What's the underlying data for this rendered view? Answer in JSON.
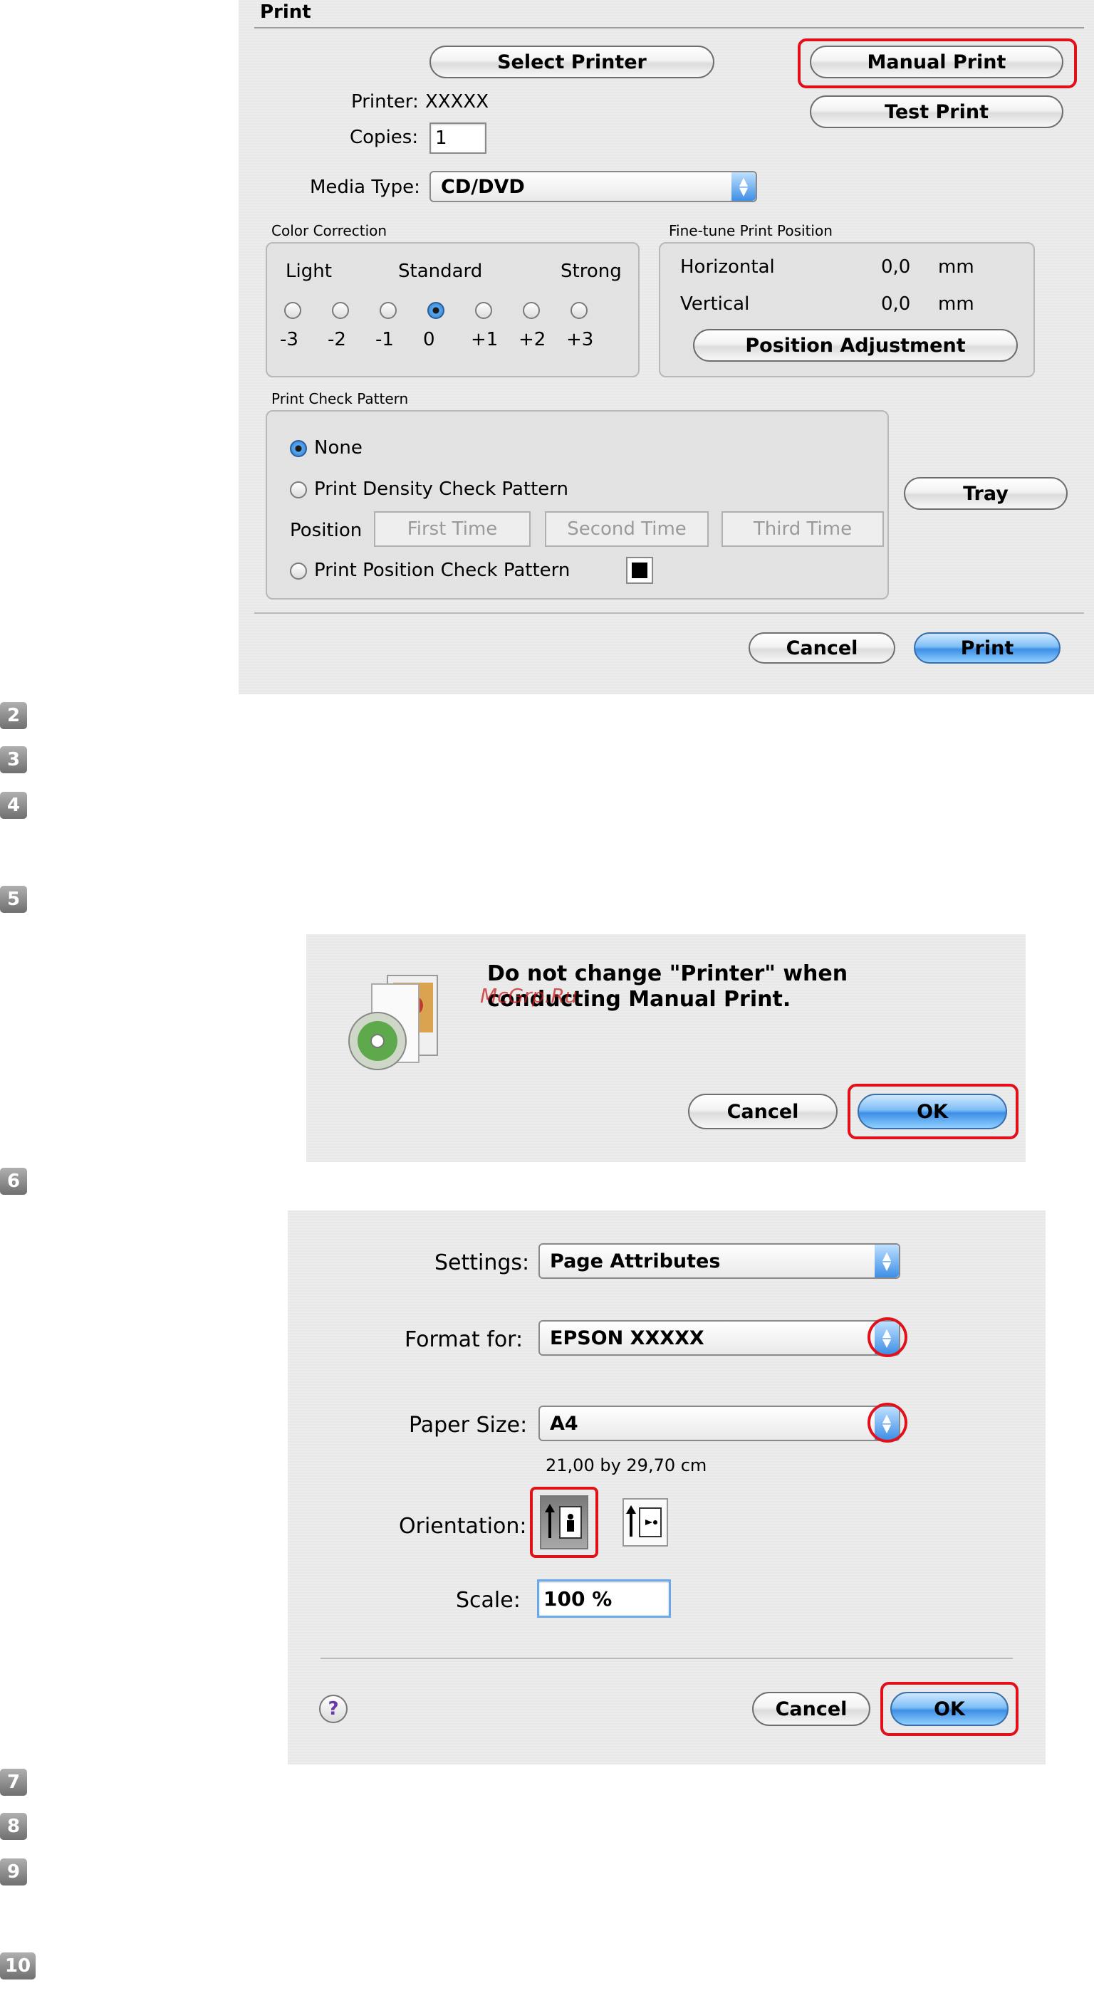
{
  "print_dialog": {
    "title": "Print",
    "select_printer": "Select Printer",
    "manual_print": "Manual Print",
    "test_print": "Test Print",
    "printer_label": "Printer:",
    "printer_value": "XXXXX",
    "copies_label": "Copies:",
    "copies_value": "1",
    "media_type_label": "Media Type:",
    "media_type_value": "CD/DVD",
    "color_correction": {
      "title": "Color Correction",
      "light": "Light",
      "standard": "Standard",
      "strong": "Strong",
      "levels": [
        "-3",
        "-2",
        "-1",
        "0",
        "+1",
        "+2",
        "+3"
      ],
      "selected": "0"
    },
    "fine_tune": {
      "title": "Fine-tune Print Position",
      "horizontal_label": "Horizontal",
      "horizontal_value": "0,0",
      "vertical_label": "Vertical",
      "vertical_value": "0,0",
      "unit": "mm",
      "position_adjustment": "Position Adjustment"
    },
    "check_pattern": {
      "title": "Print Check Pattern",
      "none": "None",
      "density": "Print Density Check Pattern",
      "position_label": "Position",
      "first_time": "First Time",
      "second_time": "Second Time",
      "third_time": "Third Time",
      "position_pattern": "Print Position Check Pattern",
      "selected": "None"
    },
    "tray": "Tray",
    "cancel": "Cancel",
    "print": "Print"
  },
  "steps": [
    "2",
    "3",
    "4",
    "5",
    "6",
    "7",
    "8",
    "9",
    "10"
  ],
  "alert": {
    "message": "Do not change \"Printer\" when conducting Manual Print.",
    "watermark": "McGrp.Ru",
    "cancel": "Cancel",
    "ok": "OK"
  },
  "page_setup": {
    "settings_label": "Settings:",
    "settings_value": "Page Attributes",
    "format_for_label": "Format for:",
    "format_for_value": "EPSON XXXXX",
    "paper_size_label": "Paper Size:",
    "paper_size_value": "A4",
    "paper_dims": "21,00 by 29,70 cm",
    "orientation_label": "Orientation:",
    "scale_label": "Scale:",
    "scale_value": "100 %",
    "help": "?",
    "cancel": "Cancel",
    "ok": "OK"
  },
  "colors": {
    "highlight_red": "#e2101a",
    "aqua_blue": "#3d8fe6"
  }
}
